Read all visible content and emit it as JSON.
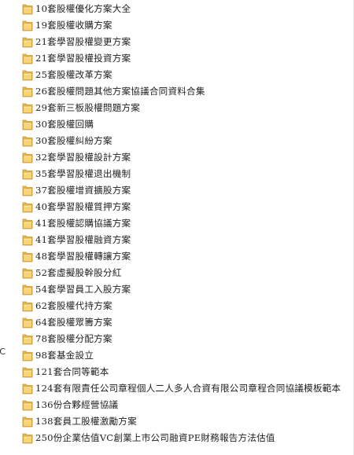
{
  "left_edge_label": "IC",
  "folders": [
    {
      "name": "10套股權優化方案大全"
    },
    {
      "name": "19套股權收購方案"
    },
    {
      "name": "21套學習股權變更方案"
    },
    {
      "name": "21套學習股權投資方案"
    },
    {
      "name": "25套股權改革方案"
    },
    {
      "name": "26套股權問題其他方案協議合同資料合集"
    },
    {
      "name": "29套新三板股權問題方案"
    },
    {
      "name": "30套股權回購"
    },
    {
      "name": "30套股權糾紛方案"
    },
    {
      "name": "32套學習股權設計方案"
    },
    {
      "name": "35套學習股權退出機制"
    },
    {
      "name": "37套股權增資擴股方案"
    },
    {
      "name": "40套學習股權質押方案"
    },
    {
      "name": "41套股權認購協議方案"
    },
    {
      "name": "41套學習股權融資方案"
    },
    {
      "name": "48套學習股權轉讓方案"
    },
    {
      "name": "52套虛擬股幹股分紅"
    },
    {
      "name": "54套學習員工入股方案"
    },
    {
      "name": "62套股權代持方案"
    },
    {
      "name": "64套股權眾籌方案"
    },
    {
      "name": "78套股權分配方案"
    },
    {
      "name": "98套基金設立"
    },
    {
      "name": "121套合同等範本"
    },
    {
      "name": "124套有限責任公司章程個人二人多人合資有限公司章程合同協議模板範本"
    },
    {
      "name": "136份合夥經營協議"
    },
    {
      "name": "138套員工股權激勵方案"
    },
    {
      "name": "250份企業估值VC創業上市公司融資PE財務報告方法估值"
    }
  ],
  "icon": "folder-icon",
  "colors": {
    "folder_front": "#f7d575",
    "folder_back": "#e8b84a",
    "folder_edge": "#c9962c",
    "background": "#ffffff"
  }
}
